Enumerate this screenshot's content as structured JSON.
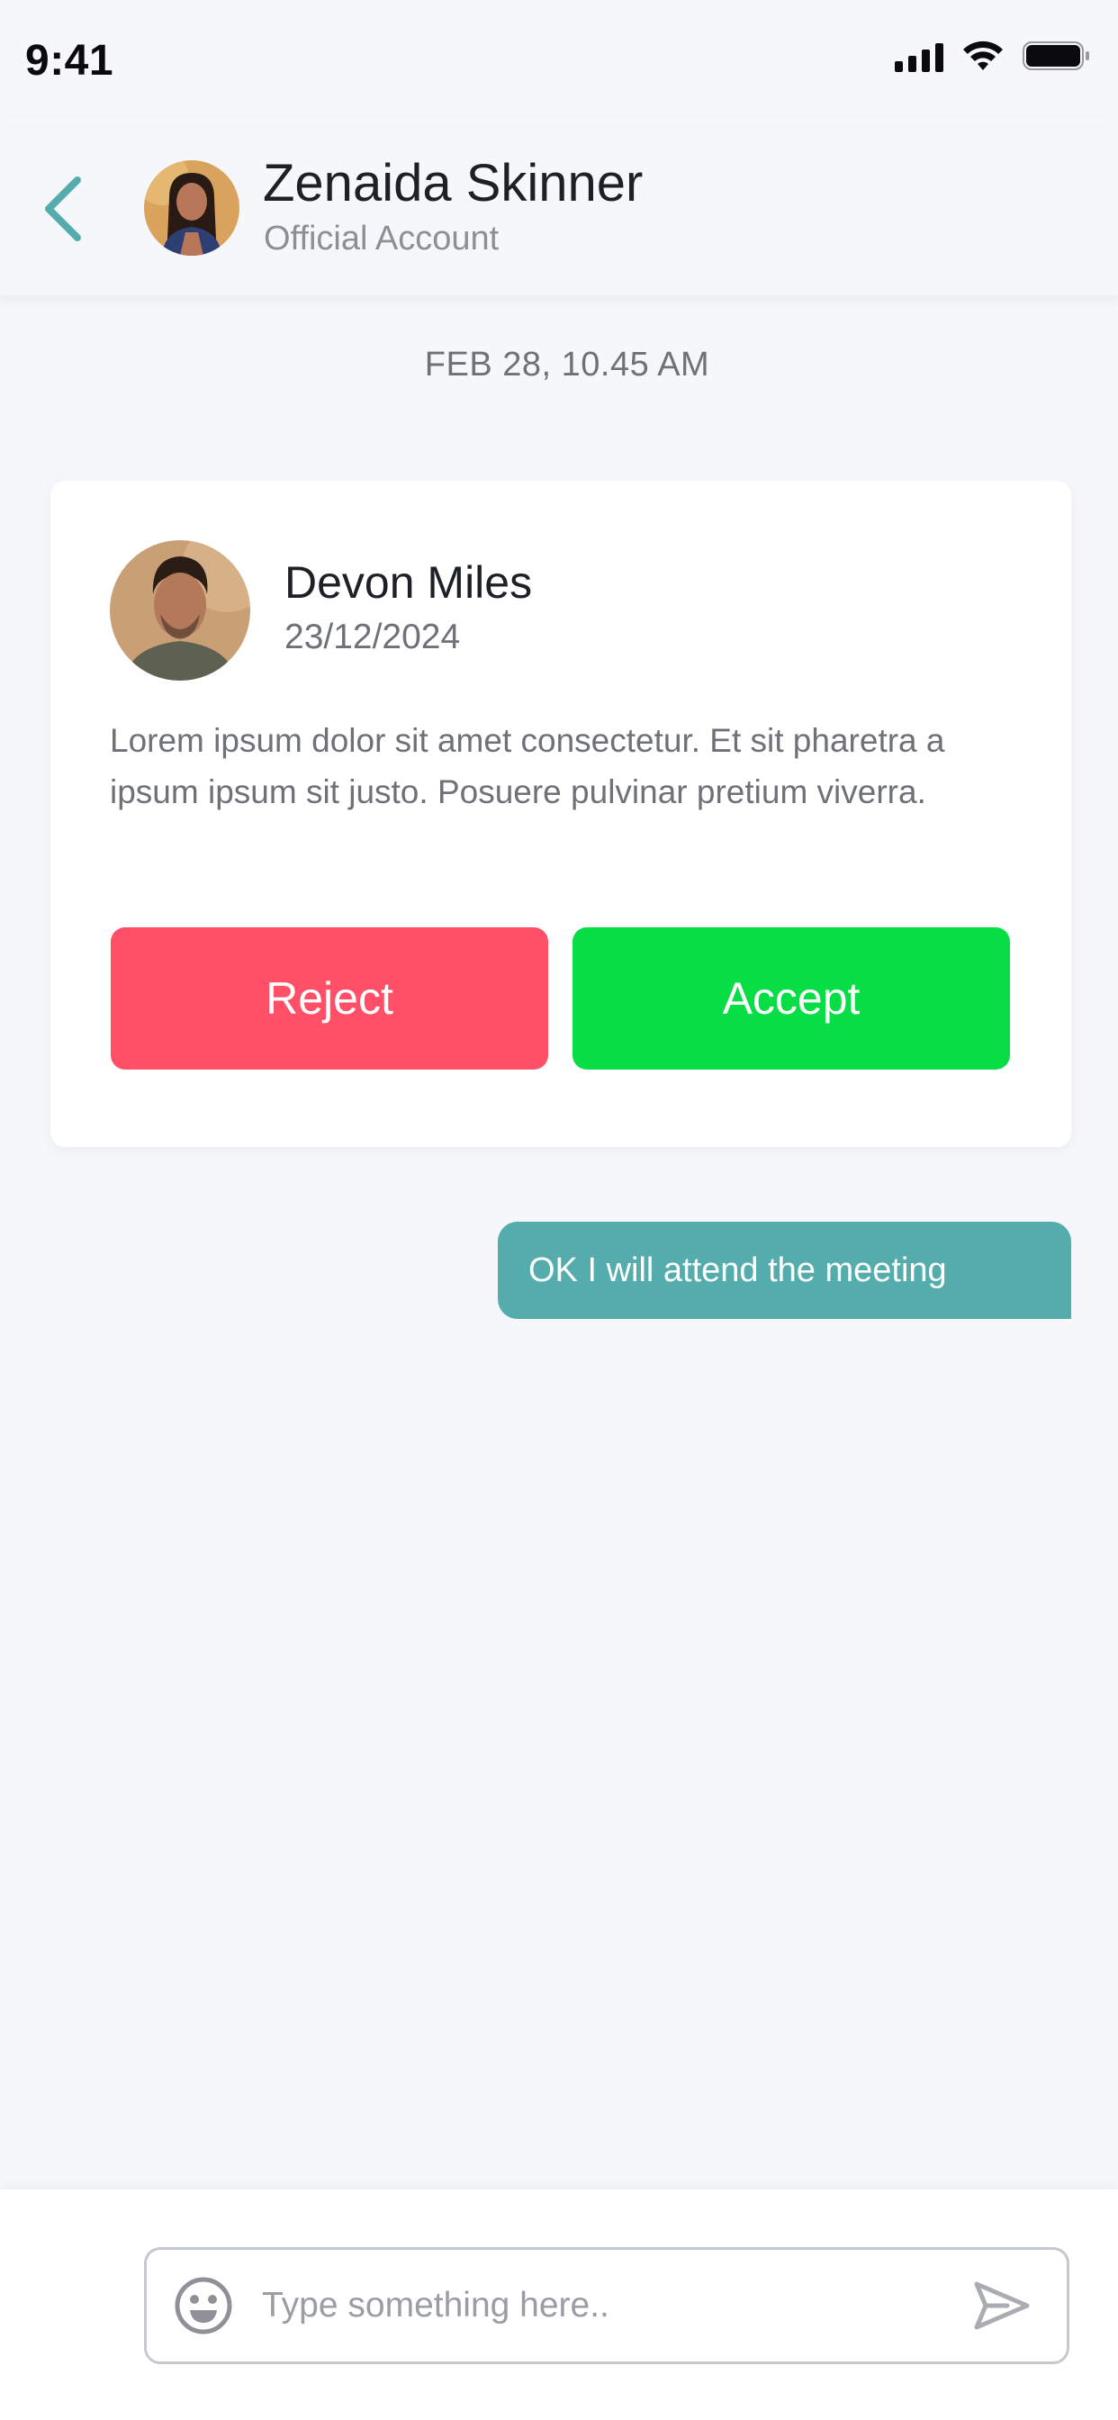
{
  "status_bar": {
    "time": "9:41"
  },
  "header": {
    "name": "Zenaida Skinner",
    "subtitle": "Official Account",
    "accent_color": "#54adac"
  },
  "conversation": {
    "date": "FEB 28, 10.45 AM",
    "invite_card": {
      "sender_name": "Devon Miles",
      "sender_date": "23/12/2024",
      "message": "Lorem ipsum dolor sit amet consectetur. Et sit pharetra a ipsum ipsum sit justo. Posuere pulvinar pretium viverra.",
      "reject_label": "Reject",
      "accept_label": "Accept",
      "reject_color": "#ff5068",
      "accept_color": "#07dd44"
    },
    "sent_message": "OK I will attend the meeting"
  },
  "composer": {
    "placeholder": "Type something here..",
    "value": ""
  },
  "icons": {
    "back": "chevron-left-icon",
    "emoji": "smiley-icon",
    "send": "send-icon",
    "signal": "cellular-signal-icon",
    "wifi": "wifi-icon",
    "battery": "battery-icon"
  }
}
